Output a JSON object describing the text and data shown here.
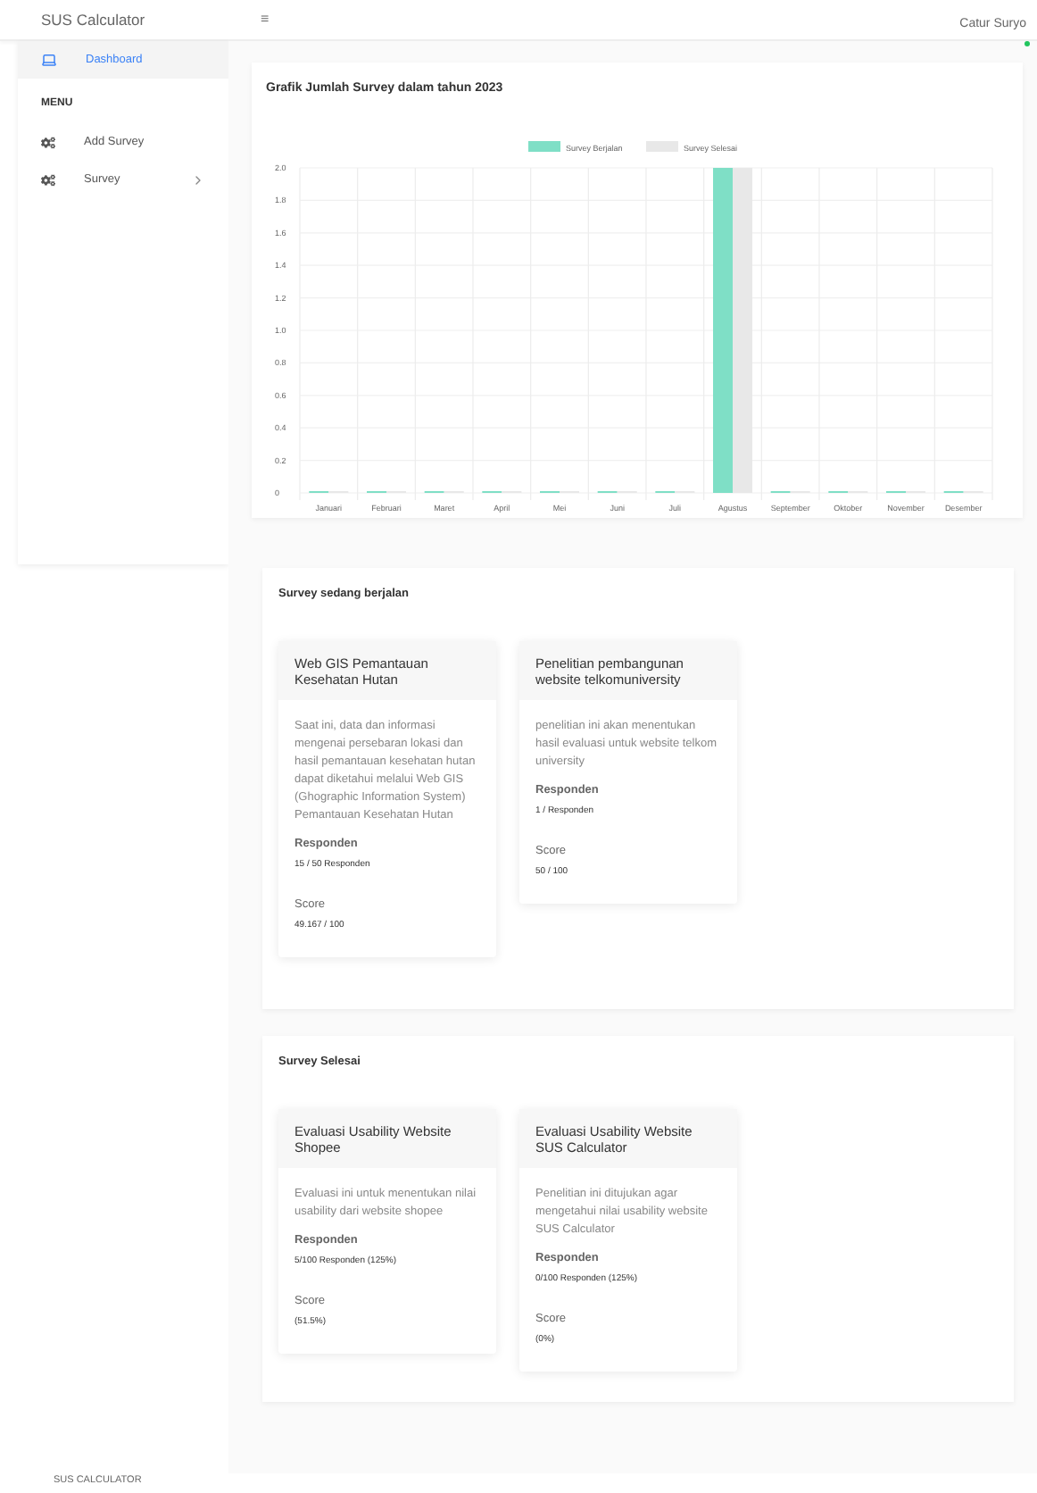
{
  "header": {
    "brand": "SUS Calculator",
    "menu_toggle": "≡",
    "user": "Catur Suryo",
    "online": true
  },
  "sidebar": {
    "items": [
      {
        "kind": "dashboard",
        "label": "Dashboard",
        "selected": true
      },
      {
        "kind": "heading",
        "label": "MENU"
      },
      {
        "kind": "link",
        "label": "Add Survey",
        "selected": false
      },
      {
        "kind": "submenu",
        "label": "Survey",
        "selected": false,
        "expanded": false
      }
    ]
  },
  "chart_card": {
    "chart_data": {
      "type": "bar",
      "title": "Grafik Jumlah Survey dalam tahun 2023",
      "categories": [
        "Januari",
        "Februari",
        "Maret",
        "April",
        "Mei",
        "Juni",
        "Juli",
        "Agustus",
        "September",
        "Oktober",
        "November",
        "Desember"
      ],
      "series": [
        {
          "name": "Survey Berjalan",
          "color": "#7fdfc6",
          "values": [
            0,
            0,
            0,
            0,
            0,
            0,
            0,
            2,
            0,
            0,
            0,
            0
          ]
        },
        {
          "name": "Survey Selesai",
          "color": "#e8e8e8",
          "values": [
            0,
            0,
            0,
            0,
            0,
            0,
            0,
            2,
            0,
            0,
            0,
            0
          ]
        }
      ],
      "grid": true,
      "legend": true,
      "ylim": [
        0,
        2
      ],
      "yticks": [
        0,
        0.2,
        0.4,
        0.6,
        0.8,
        {
          "value": 1,
          "label": "1.0"
        },
        1.2,
        1.4,
        1.6,
        1.8,
        {
          "value": 2,
          "label": "2.0"
        }
      ]
    }
  },
  "sections": [
    {
      "title": "Survey sedang berjalan",
      "surveys": [
        {
          "title": "Web GIS Pemantauan Kesehatan Hutan",
          "description": "Saat ini, data dan informasi mengenai persebaran lokasi dan hasil pemantauan kesehatan hutan dapat diketahui melalui Web GIS (Ghographic Information System) Pemantauan Kesehatan Hutan",
          "responden_label": "Responden",
          "responden": "15 / 50 Responden",
          "score_label": "Score",
          "score": "49.167 / 100"
        },
        {
          "title": "Penelitian pembangunan website telkomuniversity",
          "description": "penelitian ini akan menentukan hasil evaluasi untuk website telkom university",
          "responden_label": "Responden",
          "responden": "1 / Responden",
          "score_label": "Score",
          "score": "50 / 100"
        }
      ]
    },
    {
      "title": "Survey Selesai",
      "surveys": [
        {
          "title": "Evaluasi Usability Website Shopee",
          "description": "Evaluasi ini untuk menentukan nilai usability dari website shopee",
          "responden_label": "Responden",
          "responden": "5/100 Responden (125%)",
          "score_label": "Score",
          "score": "(51.5%)"
        },
        {
          "title": "Evaluasi Usability Website SUS Calculator",
          "description": "Penelitian ini ditujukan agar mengetahui nilai usability website SUS Calculator",
          "responden_label": "Responden",
          "responden": "0/100 Responden (125%)",
          "score_label": "Score",
          "score": "(0%)"
        }
      ]
    }
  ],
  "footer": "SUS CALCULATOR"
}
